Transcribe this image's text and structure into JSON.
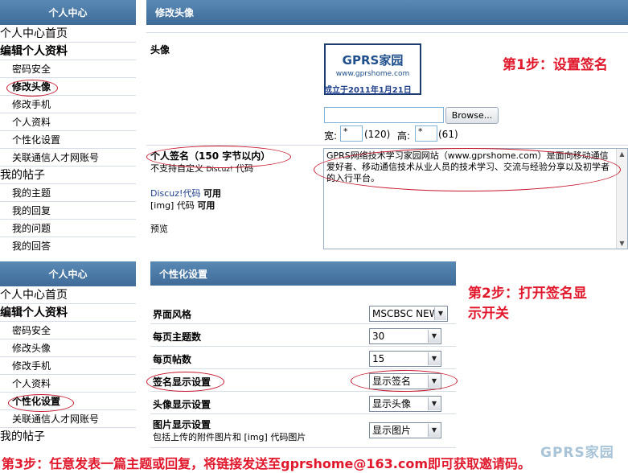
{
  "top_panel": {
    "sidebar_title": "个人中心",
    "menu": [
      "个人中心首页",
      "编辑个人资料"
    ],
    "submenu": [
      "密码安全",
      "修改头像",
      "修改手机",
      "个人资料",
      "个性化设置",
      "关联通信人才网账号"
    ],
    "posts_title": "我的帖子",
    "posts": [
      "我的主题",
      "我的回复",
      "我的问题",
      "我的回答"
    ],
    "content_title": "修改头像",
    "avatar_label": "头像",
    "logo_title": "GPRS家园",
    "logo_url": "www.gprshome.com",
    "logo_date": "成立于2011年1月21日",
    "browse_label": "Browse...",
    "width_label": "宽:",
    "width_value": "*",
    "width_hint": "(120)",
    "height_label": "高:",
    "height_value": "*",
    "height_hint": "(61)",
    "sig_label": "个人签名（150 字节以内）",
    "sig_note_prefix": "不支持自定义",
    "sig_note_discuz": "Discuz!",
    "sig_note_suffix": "代码",
    "discuz_code": "Discuz!代码",
    "discuz_allowed": "可用",
    "img_code": "[img] 代码",
    "img_allowed": "可用",
    "preview_label": "预览",
    "signature_text": "GPRS网络技术学习家园网站（www.gprshome.com）是面向移动通信爱好者、移动通信技术从业人员的技术学习、交流与经验分享以及初学者的入行平台。"
  },
  "step1": "第1步：设置签名",
  "bottom_panel": {
    "sidebar_title": "个人中心",
    "menu": [
      "个人中心首页",
      "编辑个人资料"
    ],
    "submenu": [
      "密码安全",
      "修改头像",
      "修改手机",
      "个人资料",
      "个性化设置",
      "关联通信人才网账号"
    ],
    "posts_title": "我的帖子",
    "content_title": "个性化设置",
    "rows": [
      {
        "label": "界面风格",
        "value": "MSCBSC NEW"
      },
      {
        "label": "每页主题数",
        "value": "30"
      },
      {
        "label": "每页帖数",
        "value": "15"
      },
      {
        "label": "签名显示设置",
        "value": "显示签名"
      },
      {
        "label": "头像显示设置",
        "value": "显示头像"
      },
      {
        "label": "图片显示设置",
        "value": "显示图片"
      }
    ],
    "image_note": "包括上传的附件图片和 [img] 代码图片"
  },
  "step2_line1": "第2步：打开签名显",
  "step2_line2": "示开关",
  "step3": "第3步：任意发表一篇主题或回复，将链接发送至gprshome@163.com即可获取邀请码。",
  "watermark": "GPRS家园",
  "colors": {
    "header_blue": "#4a7aa8",
    "red": "#e1182c",
    "ellipse": "#c6152b"
  }
}
